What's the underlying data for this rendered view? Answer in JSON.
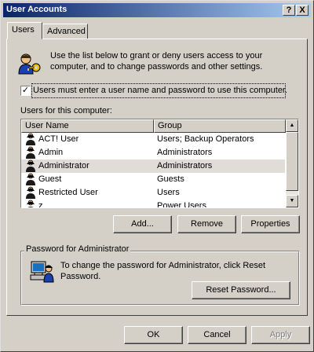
{
  "window": {
    "title": "User Accounts",
    "help_button": "?",
    "close_button": "X"
  },
  "tabs": [
    {
      "label": "Users",
      "active": true
    },
    {
      "label": "Advanced",
      "active": false
    }
  ],
  "intro": {
    "text_line1": "Use the list below to grant or deny users access to your",
    "text_line2": "computer, and to change passwords and other settings.",
    "icon": "users-keys-icon"
  },
  "require_login": {
    "label": "Users must enter a user name and password to use this computer.",
    "checked": true,
    "check_glyph": "✓"
  },
  "users_list": {
    "label": "Users for this computer:",
    "columns": [
      "User Name",
      "Group"
    ],
    "rows": [
      {
        "name": "ACT! User",
        "group": "Users; Backup Operators",
        "selected": false
      },
      {
        "name": "Admin",
        "group": "Administrators",
        "selected": false
      },
      {
        "name": "Administrator",
        "group": "Administrators",
        "selected": true
      },
      {
        "name": "Guest",
        "group": "Guests",
        "selected": false
      },
      {
        "name": "Restricted User",
        "group": "Users",
        "selected": false
      },
      {
        "name": "z",
        "group": "Power Users",
        "selected": false
      }
    ],
    "scroll_up": "▲",
    "scroll_down": "▼"
  },
  "list_buttons": {
    "add": "Add...",
    "remove": "Remove",
    "properties": "Properties"
  },
  "password_group": {
    "legend": "Password for Administrator",
    "text_line1": "To change the password for Administrator, click Reset",
    "text_line2": "Password.",
    "reset_button": "Reset Password...",
    "icon": "computer-user-icon"
  },
  "dialog_buttons": {
    "ok": "OK",
    "cancel": "Cancel",
    "apply": "Apply",
    "apply_enabled": false
  }
}
